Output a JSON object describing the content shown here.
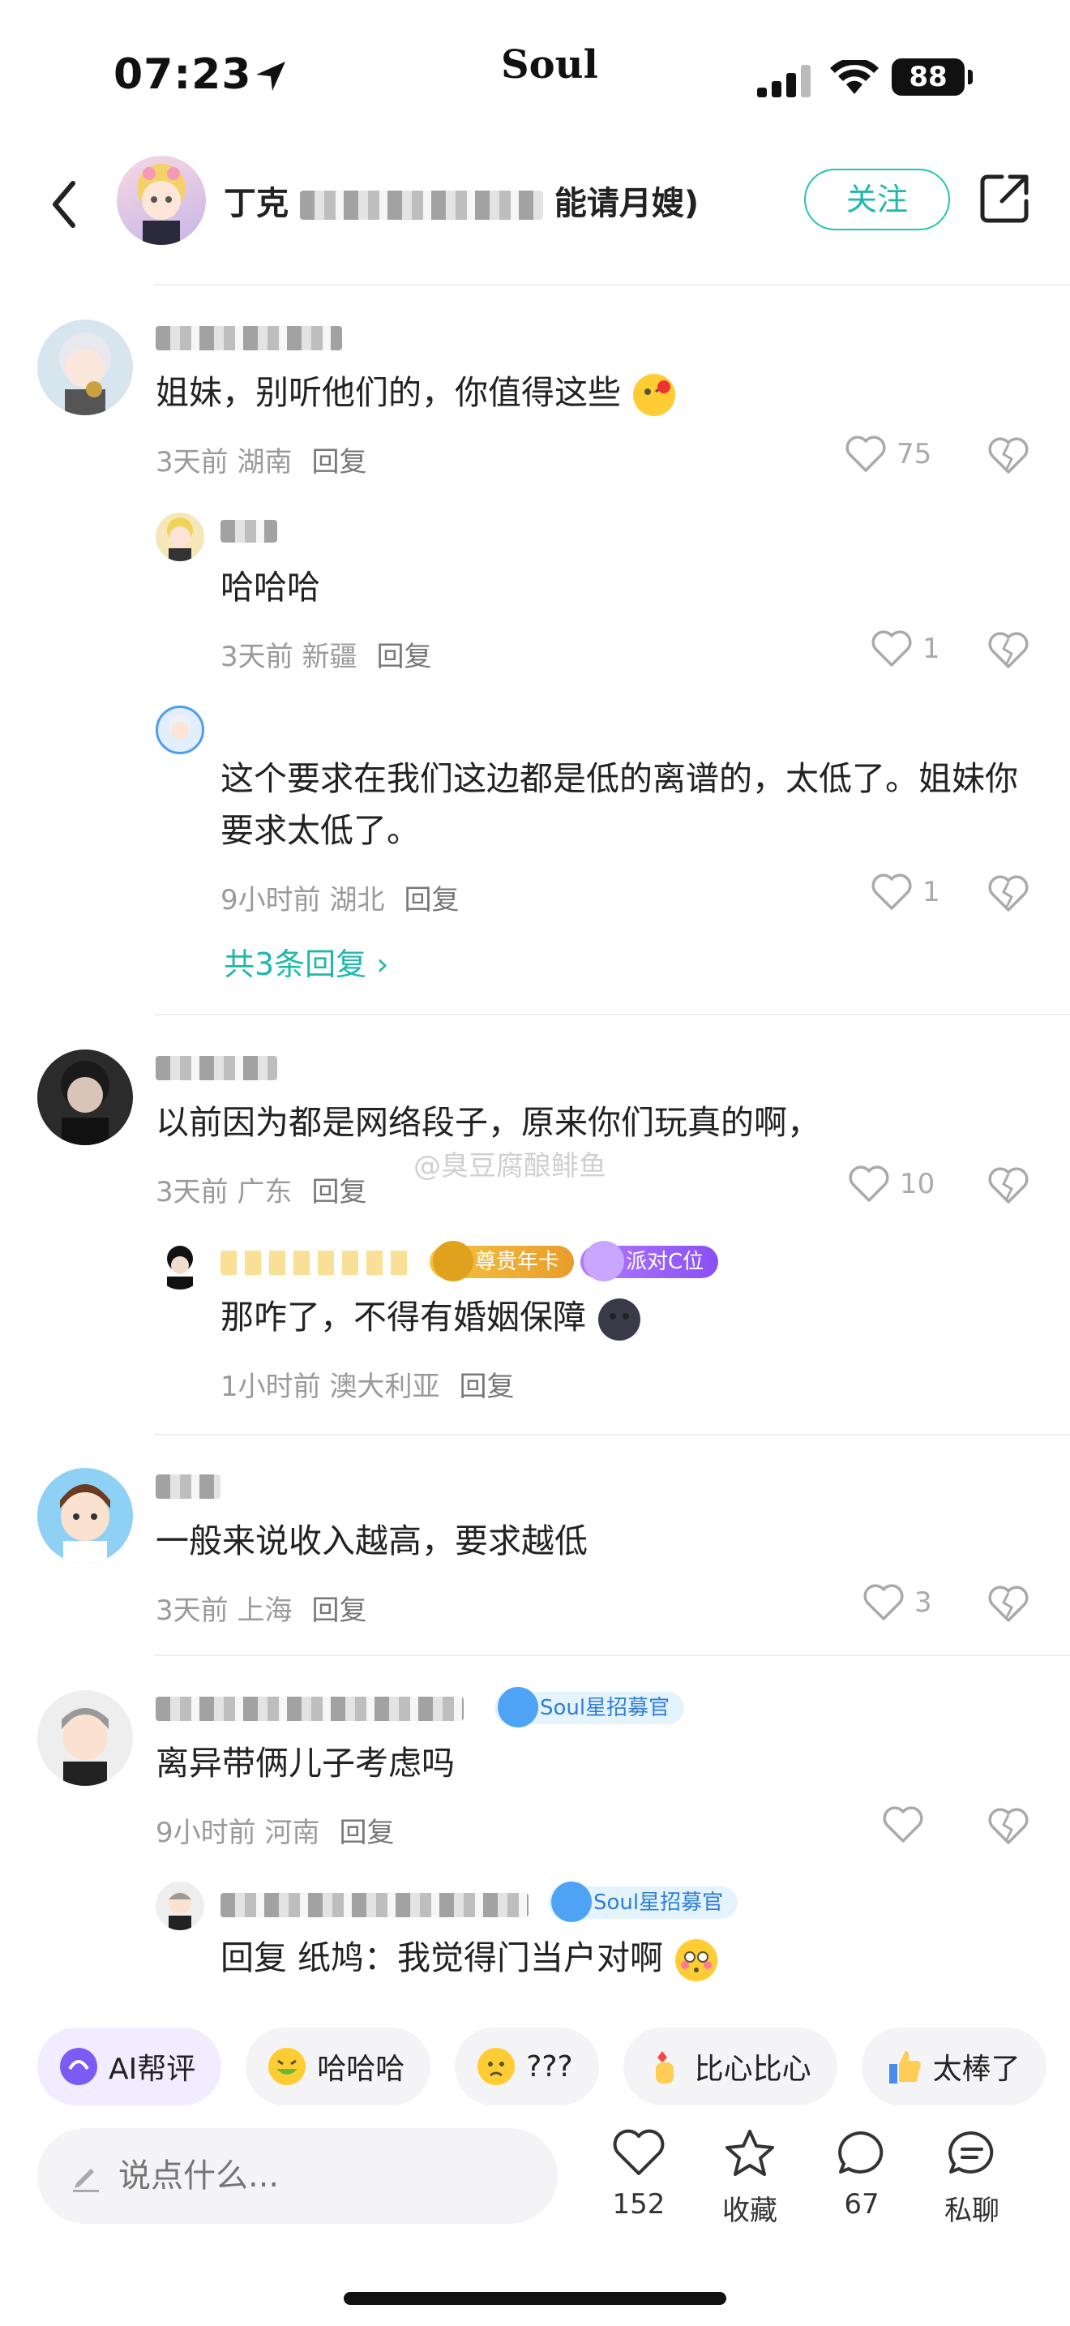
{
  "status": {
    "time": "07:23",
    "app_logo": "Soul",
    "battery": "88"
  },
  "header": {
    "name": "丁克",
    "name_tail": "能请月嫂)",
    "follow_label": "关注",
    "icons": {
      "back": "back-chevron-icon",
      "share": "share-external-icon"
    }
  },
  "comments": [
    {
      "text": "姐妹，别听他们的，你值得这些",
      "time": "3天前",
      "location": "湖南",
      "reply_label": "回复",
      "likes": "75"
    },
    {
      "text": "哈哈哈",
      "time": "3天前",
      "location": "新疆",
      "reply_label": "回复",
      "likes": "1"
    },
    {
      "text": "这个要求在我们这边都是低的离谱的，太低了。姐妹你要求太低了。",
      "time": "9小时前",
      "location": "湖北",
      "reply_label": "回复",
      "likes": "1"
    },
    {
      "text": "以前因为都是网络段子，原来你们玩真的啊，",
      "time": "3天前",
      "location": "广东",
      "reply_label": "回复",
      "likes": "10"
    },
    {
      "text": "那咋了，不得有婚姻保障",
      "time": "1小时前",
      "location": "澳大利亚",
      "reply_label": "回复",
      "likes": "",
      "badges": [
        "尊贵年卡",
        "派对C位"
      ]
    },
    {
      "text": "一般来说收入越高，要求越低",
      "time": "3天前",
      "location": "上海",
      "reply_label": "回复",
      "likes": "3"
    },
    {
      "text": "离异带俩儿子考虑吗",
      "time": "9小时前",
      "location": "河南",
      "reply_label": "回复",
      "likes": "",
      "badges": [
        "Soul星招募官"
      ]
    },
    {
      "text": "回复 纸鸠：我觉得门当户对啊",
      "badges": [
        "Soul星招募官"
      ]
    }
  ],
  "more_replies": "共3条回复",
  "watermark": "@臭豆腐酿鲱鱼",
  "chips": [
    {
      "label": "AI帮评",
      "icon": "ai-icon"
    },
    {
      "label": "哈哈哈",
      "icon": "laughing-emoji-icon"
    },
    {
      "label": "???",
      "icon": "confused-emoji-icon"
    },
    {
      "label": "比心比心",
      "icon": "finger-heart-icon"
    },
    {
      "label": "太棒了",
      "icon": "thumbs-up-icon"
    }
  ],
  "bottom": {
    "input_placeholder": "说点什么...",
    "likes": "152",
    "favorite": "收藏",
    "comments": "67",
    "dm": "私聊"
  },
  "colors": {
    "accent": "#1fb8ac",
    "meta": "#9a9a9a"
  }
}
